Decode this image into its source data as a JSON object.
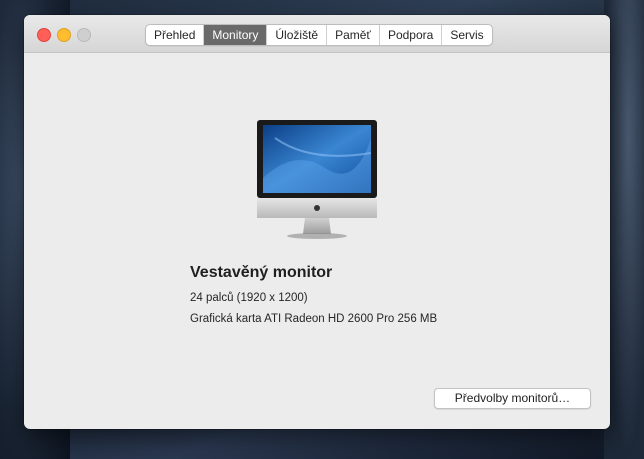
{
  "window": {
    "tabs": [
      {
        "label": "Přehled",
        "active": false
      },
      {
        "label": "Monitory",
        "active": true
      },
      {
        "label": "Úložiště",
        "active": false
      },
      {
        "label": "Paměť",
        "active": false
      },
      {
        "label": "Podpora",
        "active": false
      },
      {
        "label": "Servis",
        "active": false
      }
    ]
  },
  "display": {
    "title": "Vestavěný monitor",
    "size_resolution": "24 palců (1920 x 1200)",
    "graphics": "Grafická karta ATI Radeon HD 2600 Pro 256 MB",
    "icon": "imac-icon"
  },
  "actions": {
    "preferences_label": "Předvolby monitorů…"
  },
  "colors": {
    "close": "#fe5f57",
    "minimize": "#febc2e",
    "active_tab": "#6a6a6a"
  }
}
